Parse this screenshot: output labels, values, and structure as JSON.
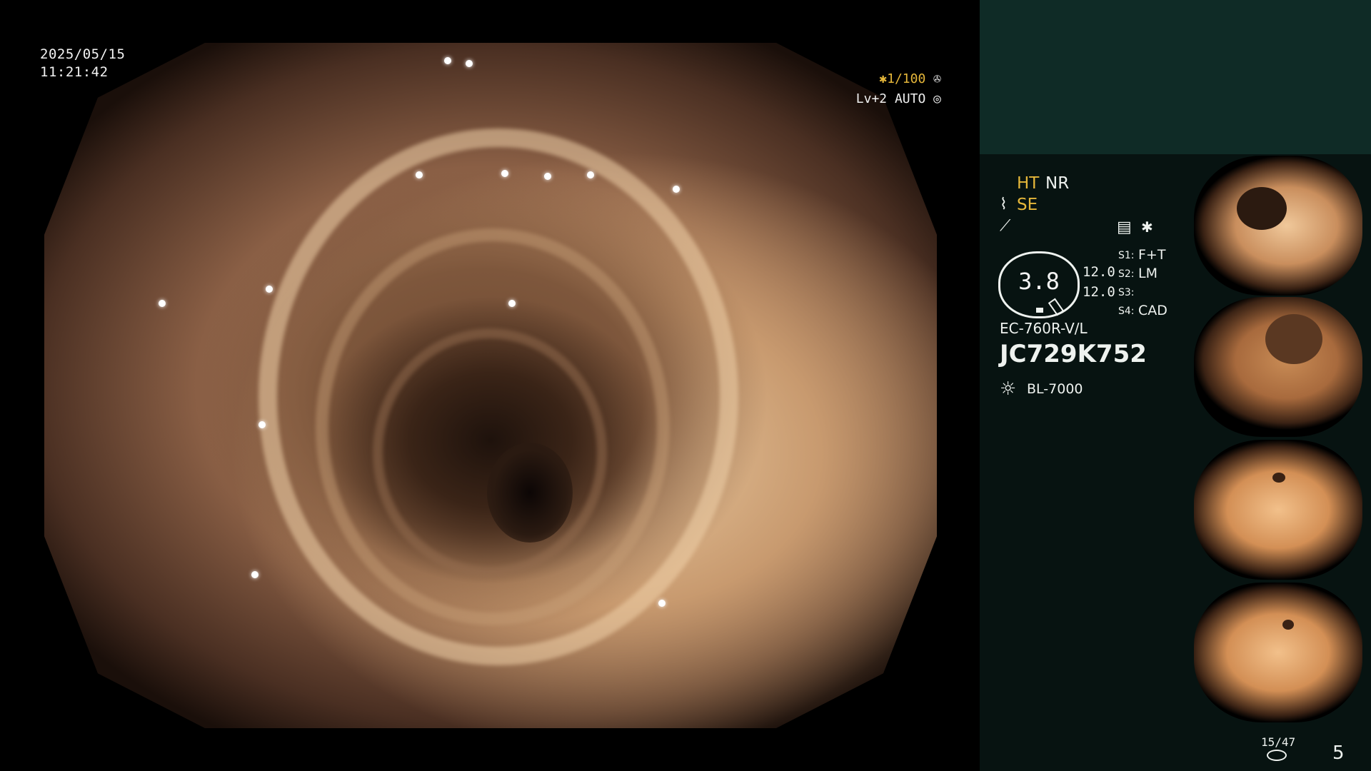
{
  "datetime": {
    "date": "2025/05/15",
    "time": "11:21:42"
  },
  "overlay": {
    "shutter": "✱1/100",
    "shutter_icon": "aperture-icon",
    "level": "Lv+2 AUTO",
    "level_icon": "iris-icon"
  },
  "panel": {
    "ht": "HT",
    "nr": "NR",
    "se": "SE",
    "freeze_symbol": "⟋",
    "menu_icon": "settings-icon",
    "star": "✱",
    "zoom_value": "3.8",
    "bright1": "12.0",
    "bright2": "12.0",
    "s1_label": "S1:",
    "s1_value": "F+T",
    "s2_label": "S2:",
    "s2_value": "LM",
    "s3_label": "S3:",
    "s3_value": "",
    "s4_label": "S4:",
    "s4_value": "CAD",
    "scope_model": "EC-760R-V/L",
    "serial": "JC729K752",
    "light_source": "BL-7000"
  },
  "footer": {
    "storage": "15/47",
    "count": "5"
  },
  "colors": {
    "panel_bg": "#071311",
    "panel_top": "#0f2b26",
    "accent": "#e6b73a"
  }
}
